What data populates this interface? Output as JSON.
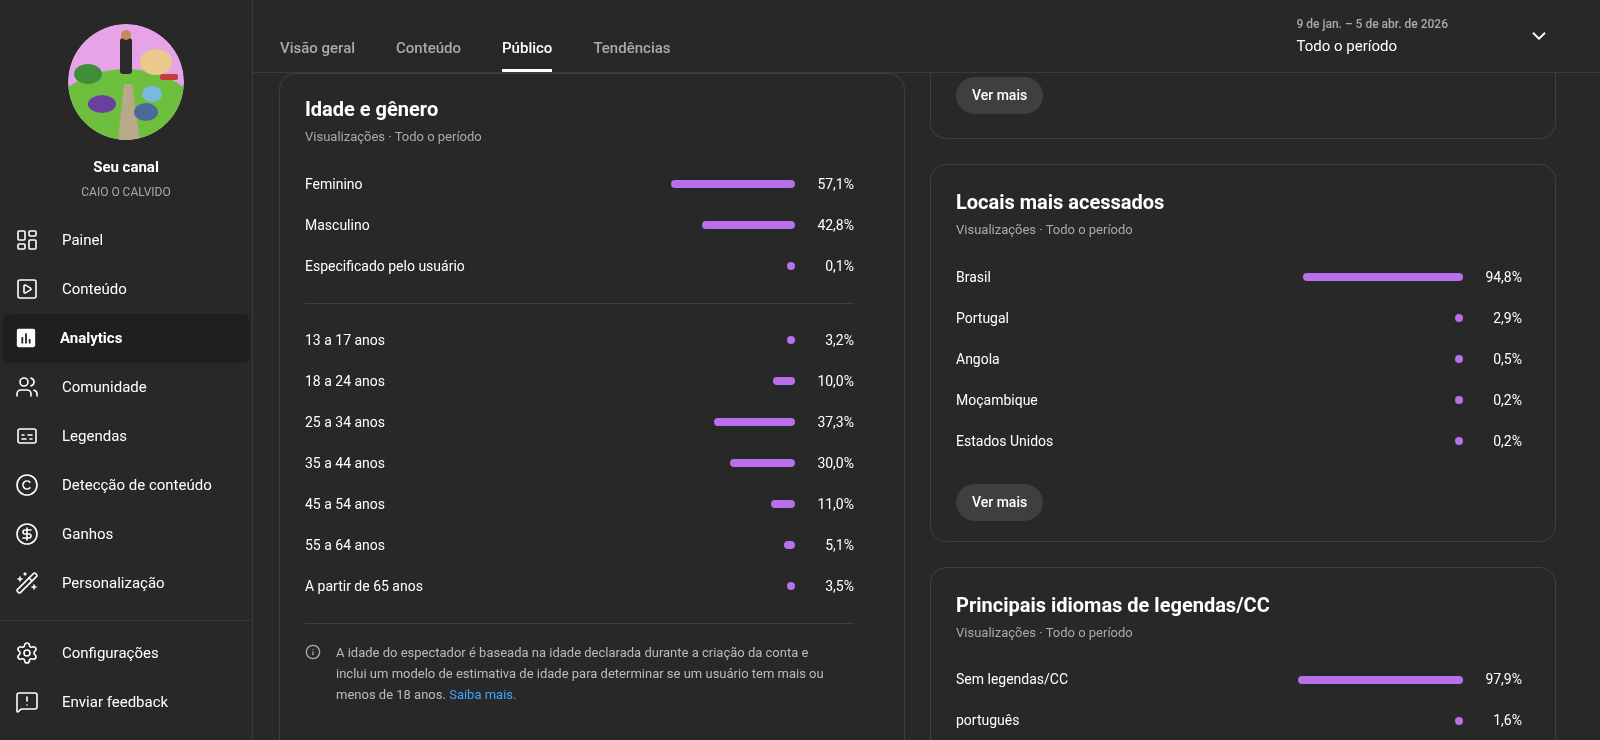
{
  "sidebar": {
    "channel": {
      "title": "Seu canal",
      "name": "CAIO O CALVIDO"
    },
    "items": [
      {
        "label": "Painel",
        "selected": false
      },
      {
        "label": "Conteúdo",
        "selected": false
      },
      {
        "label": "Analytics",
        "selected": true
      },
      {
        "label": "Comunidade",
        "selected": false
      },
      {
        "label": "Legendas",
        "selected": false
      },
      {
        "label": "Detecção de conteúdo",
        "selected": false
      },
      {
        "label": "Ganhos",
        "selected": false
      },
      {
        "label": "Personalização",
        "selected": false
      }
    ],
    "footer_items": [
      {
        "label": "Configurações",
        "selected": false
      },
      {
        "label": "Enviar feedback",
        "selected": false
      }
    ]
  },
  "header": {
    "tabs": [
      {
        "label": "Visão geral",
        "selected": false
      },
      {
        "label": "Conteúdo",
        "selected": false
      },
      {
        "label": "Público",
        "selected": true
      },
      {
        "label": "Tendências",
        "selected": false
      }
    ],
    "date_range": {
      "dates": "9 de jan. – 5 de abr. de 2026",
      "label": "Todo o período"
    }
  },
  "age_gender": {
    "title": "Idade e gênero",
    "subtitle": "Visualizações · Todo o período",
    "sections": [
      {
        "rows": [
          {
            "label": "Feminino",
            "value": "57,1%"
          },
          {
            "label": "Masculino",
            "value": "42,8%"
          },
          {
            "label": "Especificado pelo usuário",
            "value": "0,1%"
          }
        ]
      },
      {
        "rows": [
          {
            "label": "13 a 17 anos",
            "value": "3,2%"
          },
          {
            "label": "18 a 24 anos",
            "value": "10,0%"
          },
          {
            "label": "25 a 34 anos",
            "value": "37,3%"
          },
          {
            "label": "35 a 44 anos",
            "value": "30,0%"
          },
          {
            "label": "45 a 54 anos",
            "value": "11,0%"
          },
          {
            "label": "55 a 64 anos",
            "value": "5,1%"
          },
          {
            "label": "A partir de 65 anos",
            "value": "3,5%"
          }
        ]
      }
    ],
    "note": {
      "text": "A idade do espectador é baseada na idade declarada durante a criação da conta e inclui um modelo de estimativa de idade para determinar se um usuário tem mais ou menos de 18 anos.",
      "link": "Saiba mais."
    }
  },
  "right_cards": [
    {
      "kind": "tail",
      "button": "Ver mais"
    },
    {
      "kind": "full",
      "title": "Locais mais acessados",
      "subtitle": "Visualizações · Todo o período",
      "button": "Ver mais",
      "rows": [
        {
          "label": "Brasil",
          "value": "94,8%"
        },
        {
          "label": "Portugal",
          "value": "2,9%"
        },
        {
          "label": "Angola",
          "value": "0,5%"
        },
        {
          "label": "Moçambique",
          "value": "0,2%"
        },
        {
          "label": "Estados Unidos",
          "value": "0,2%"
        }
      ]
    },
    {
      "kind": "full",
      "title": "Principais idiomas de legendas/CC",
      "subtitle": "Visualizações · Todo o período",
      "rows": [
        {
          "label": "Sem legendas/CC",
          "value": "97,9%"
        },
        {
          "label": "português",
          "value": "1,6%"
        }
      ]
    }
  ]
}
